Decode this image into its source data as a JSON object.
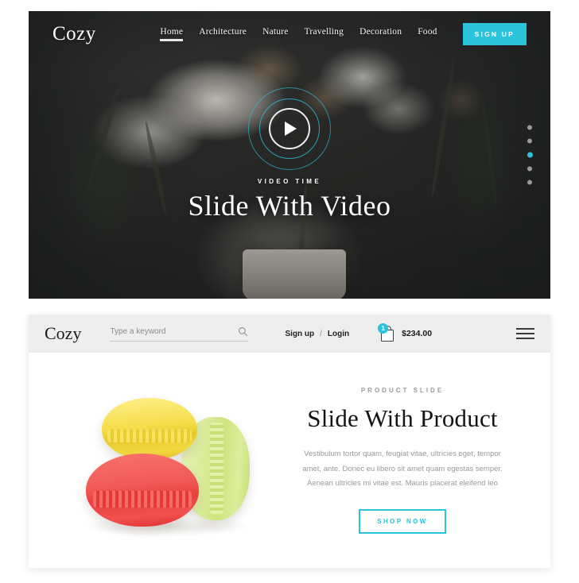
{
  "hero": {
    "logo": "Cozy",
    "nav": [
      {
        "label": "Home",
        "active": true
      },
      {
        "label": "Architecture",
        "active": false
      },
      {
        "label": "Nature",
        "active": false
      },
      {
        "label": "Travelling",
        "active": false
      },
      {
        "label": "Decoration",
        "active": false
      },
      {
        "label": "Food",
        "active": false
      }
    ],
    "signup_label": "SIGN UP",
    "eyebrow": "VIDEO TIME",
    "title": "Slide With Video",
    "play_icon": "play-icon",
    "dots": [
      {
        "active": false
      },
      {
        "active": false
      },
      {
        "active": true
      },
      {
        "active": false
      },
      {
        "active": false
      }
    ],
    "accent_color": "#2cc3dc"
  },
  "shop": {
    "logo": "Cozy",
    "search": {
      "placeholder": "Type a keyword",
      "value": "",
      "icon": "search-icon"
    },
    "account": {
      "signup_label": "Sign up",
      "separator": "/",
      "login_label": "Login"
    },
    "cart": {
      "icon": "shopping-bag-icon",
      "count": "1",
      "total": "$234.00",
      "badge_color": "#2cc3dc"
    },
    "menu_icon": "hamburger-menu-icon",
    "product": {
      "eyebrow": "PRODUCT SLIDE",
      "title": "Slide With Product",
      "description": "Vestibulum tortor quam, feugiat vitae, ultricies eget, tempor amet, ante. Donec eu libero sit amet quam egestas semper. Aenean ultricies mi vitae est. Mauris placerat eleifend leo",
      "cta_label": "SHOP NOW",
      "cta_color": "#2cc3dc",
      "image_alt": "macarons-image"
    }
  }
}
